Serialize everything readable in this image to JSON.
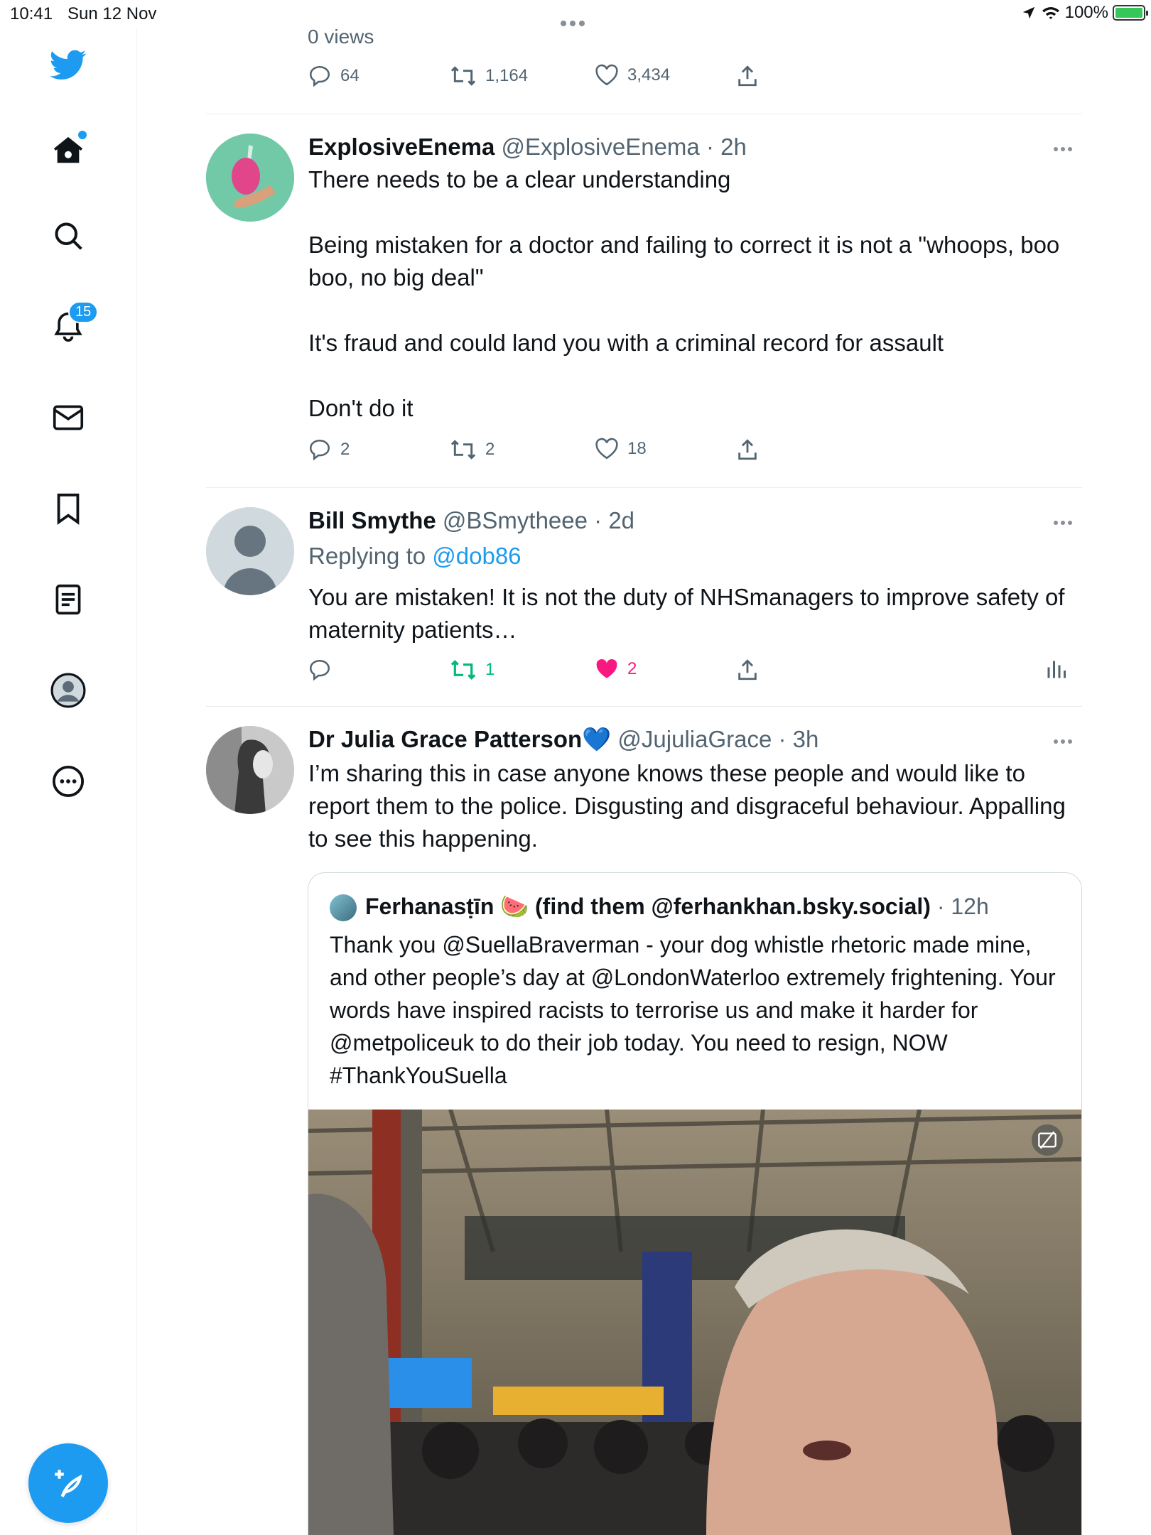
{
  "status_bar": {
    "time": "10:41",
    "date": "Sun 12 Nov",
    "battery": "100%"
  },
  "sidebar": {
    "notifications_badge": "15"
  },
  "top_tweet": {
    "views": "0 views",
    "replies": "64",
    "retweets": "1,164",
    "likes": "3,434"
  },
  "tweets": [
    {
      "name": "ExplosiveEnema",
      "handle": "@ExplosiveEnema",
      "time": "· 2h",
      "lines": [
        "There needs to be a clear understanding",
        "Being mistaken for a doctor and failing to correct it is not a \"whoops, boo boo, no big deal\"",
        "It's fraud and could land you with a criminal record for assault",
        "Don't do it"
      ],
      "replies": "2",
      "retweets": "2",
      "likes": "18"
    },
    {
      "name": "Bill Smythe",
      "handle": "@BSmytheee",
      "time": "· 2d",
      "replying_prefix": "Replying to ",
      "replying_to": "@dob86",
      "text": "You are mistaken! It is not the duty of NHSmanagers to improve safety of maternity patients…",
      "retweets": "1",
      "likes": "2"
    },
    {
      "name": "Dr Julia Grace Patterson",
      "emoji": "💙",
      "handle": "@JujuliaGrace",
      "time": "· 3h",
      "text": "I’m sharing this in case anyone knows these people and would like to report them to the police. Disgusting and disgraceful behaviour. Appalling to see this happening.",
      "quote": {
        "name": "Ferhanasṭīn 🍉 (find them @ferhankhan.bsky.social)",
        "time": "· 12h",
        "text": "Thank you @SuellaBraverman - your dog whistle rhetoric made mine, and other people’s day at @LondonWaterloo extremely frightening.  Your words have inspired racists to terrorise us and make it harder for @metpoliceuk to do their job today.  You need to resign, NOW #ThankYouSuella"
      }
    }
  ],
  "colors": {
    "accent": "#1d9bf0",
    "retweet_active": "#00ba7c",
    "like_active": "#f91880",
    "secondary_text": "#536471"
  }
}
